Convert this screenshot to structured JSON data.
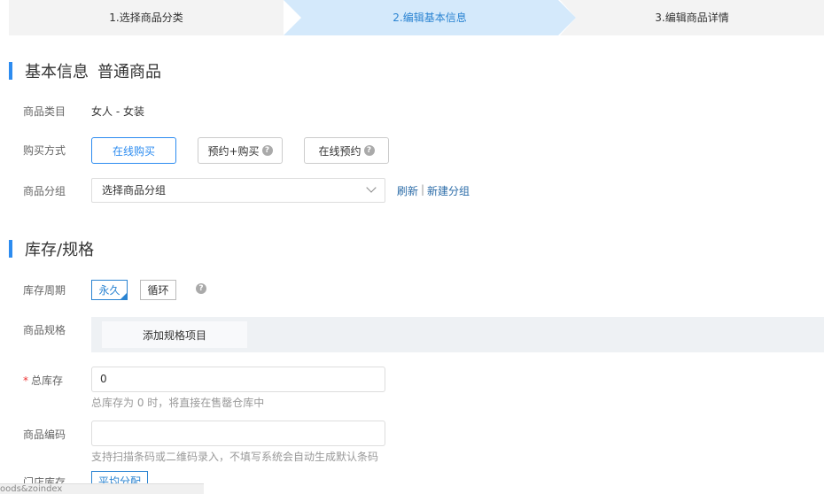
{
  "steps": [
    {
      "label": "1.选择商品分类"
    },
    {
      "label": "2.编辑基本信息"
    },
    {
      "label": "3.编辑商品详情"
    }
  ],
  "basic": {
    "title": "基本信息",
    "subtitle": "普通商品",
    "category_label": "商品类目",
    "category_value": "女人 - 女装",
    "purchase_label": "购买方式",
    "purchase_options": [
      "在线购买",
      "预约+购买",
      "在线预约"
    ],
    "group_label": "商品分组",
    "group_select": "选择商品分组",
    "refresh_link": "刷新",
    "separator": "|",
    "new_group_link": "新建分组"
  },
  "stock": {
    "title": "库存/规格",
    "period_label": "库存周期",
    "period_options": [
      "永久",
      "循环"
    ],
    "spec_label": "商品规格",
    "add_spec_button": "添加规格项目",
    "total_label": "总库存",
    "total_required": "*",
    "total_value": "0",
    "total_hint": "总库存为 0 时，将直接在售罄仓库中",
    "code_label": "商品编码",
    "code_value": "",
    "code_hint": "支持扫描条码或二维码录入，不填写系统会自动生成默认条码",
    "store_label": "门店库存",
    "store_button": "平均分配"
  },
  "help_glyph": "?",
  "status_strip": "oods&zoindex"
}
